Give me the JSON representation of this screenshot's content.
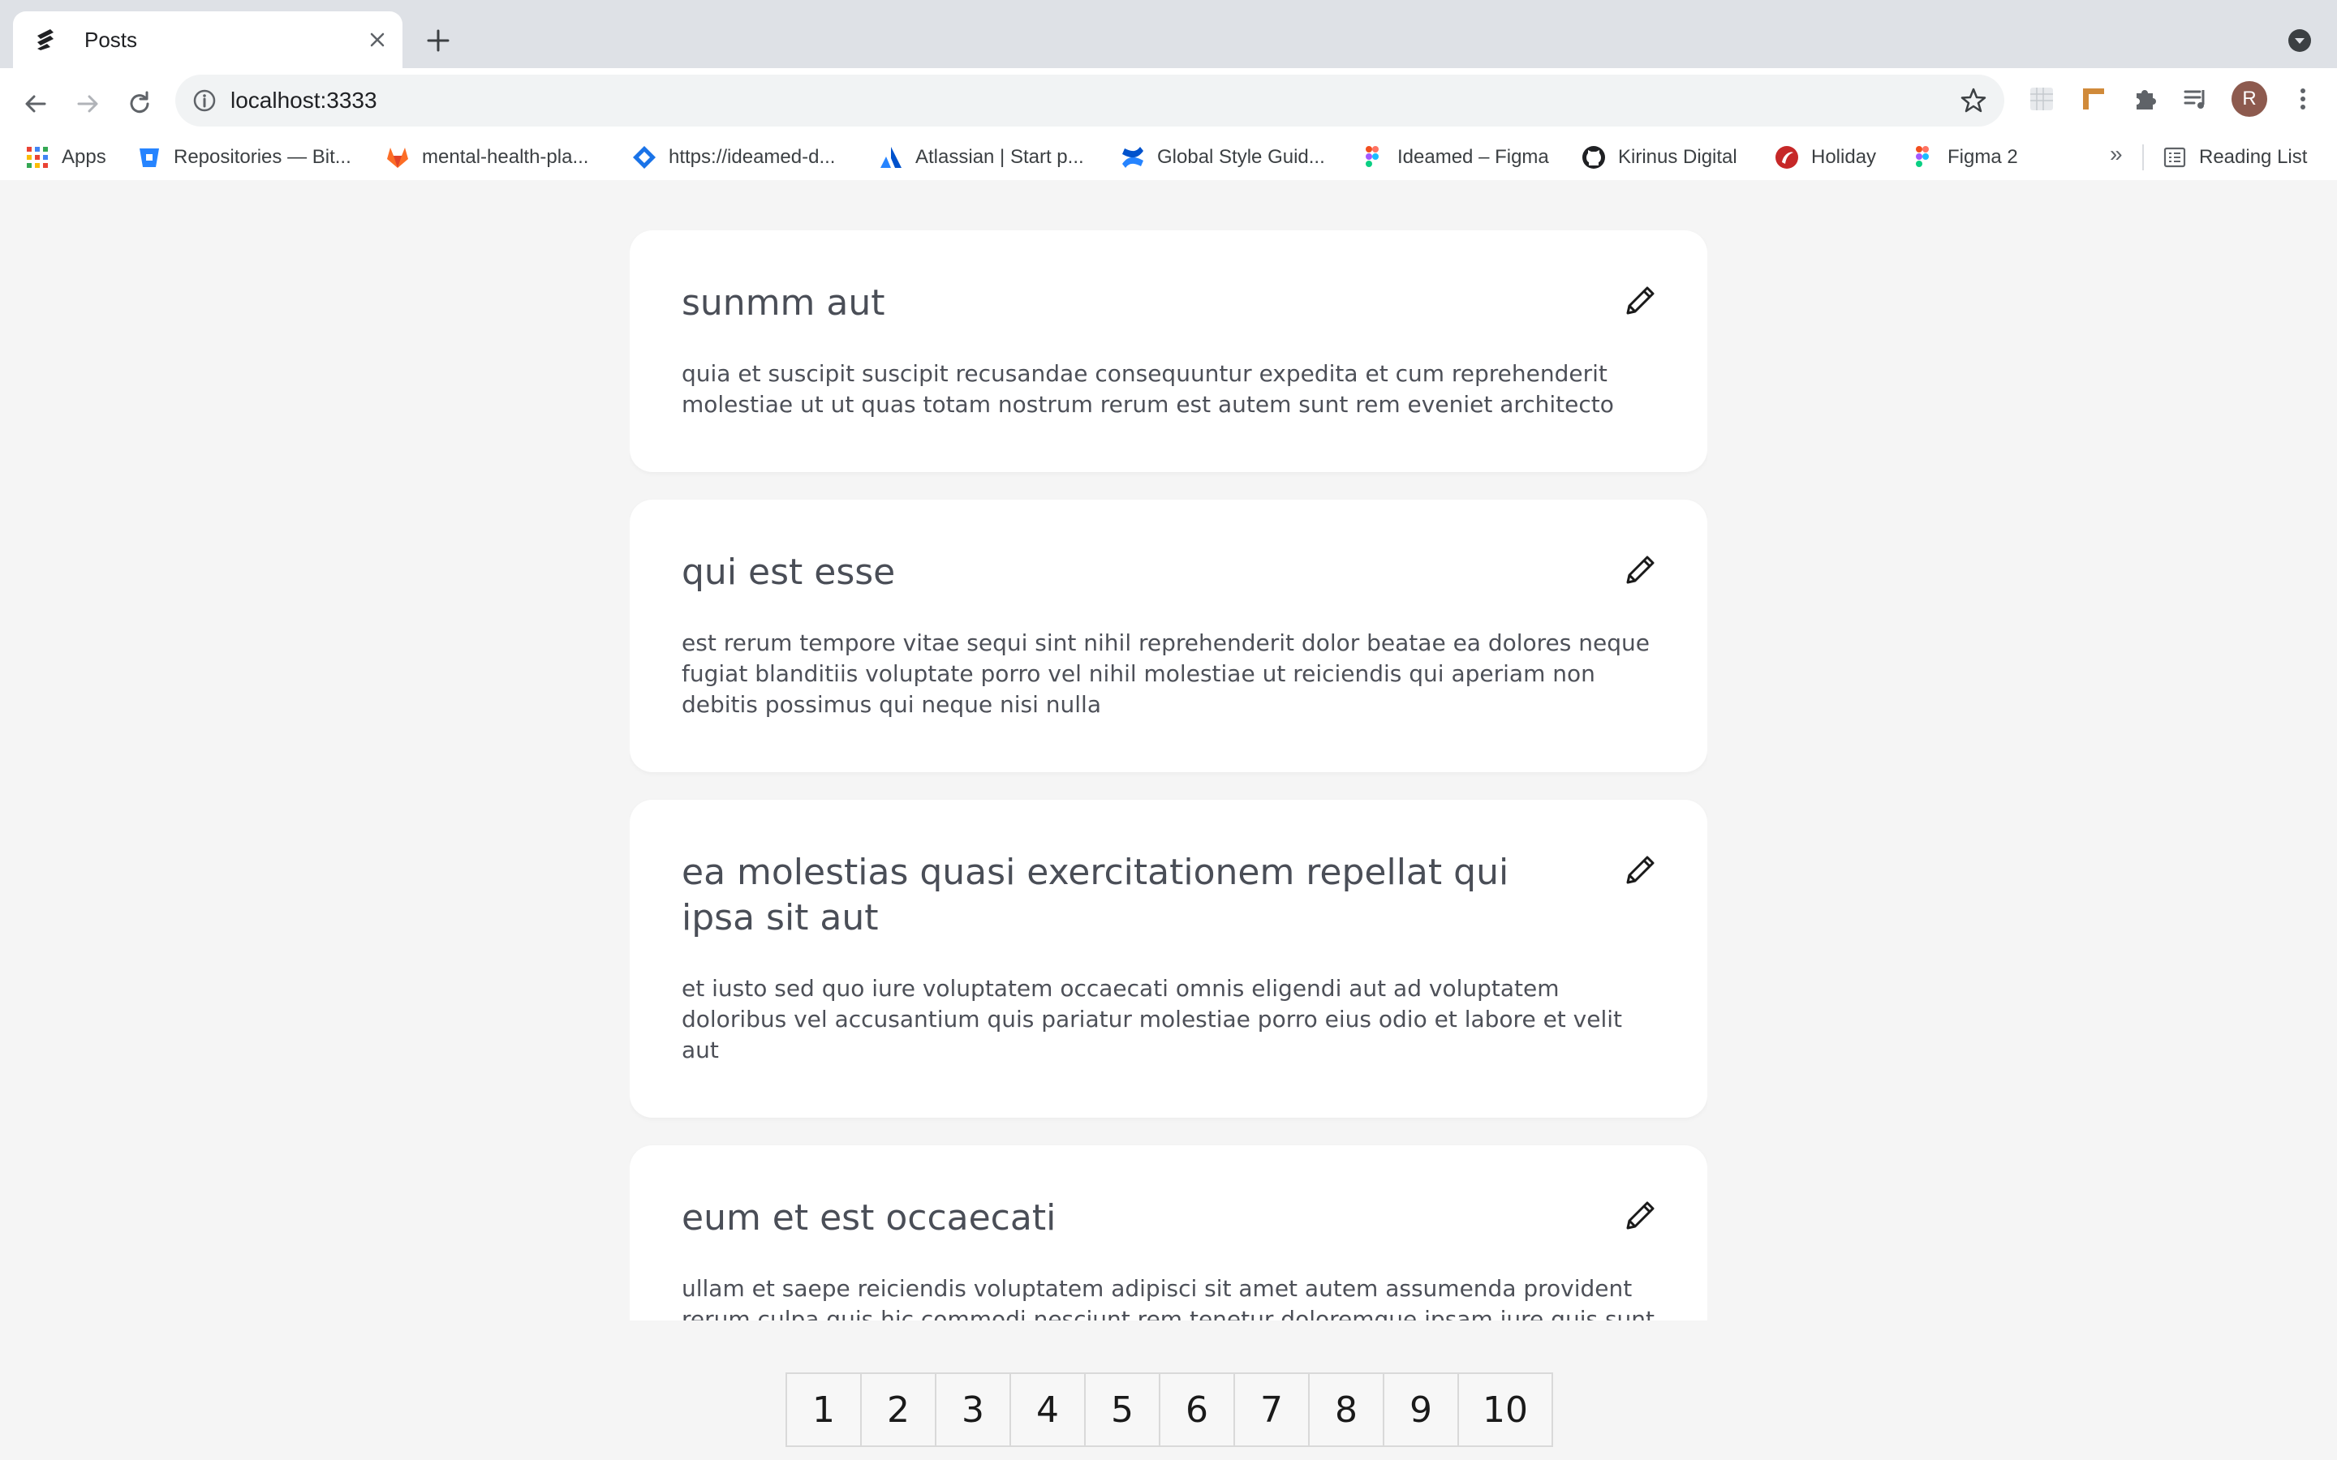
{
  "browser": {
    "tab": {
      "title": "Posts"
    },
    "address": {
      "url": "localhost:3333"
    },
    "profile_initial": "R",
    "bookmarks": [
      {
        "label": "Apps",
        "icon": "apps-grid-icon"
      },
      {
        "label": "Repositories — Bit...",
        "icon": "bitbucket-icon"
      },
      {
        "label": "mental-health-pla...",
        "icon": "gitlab-icon"
      },
      {
        "label": "https://ideamed-d...",
        "icon": "diamond-icon"
      },
      {
        "label": "Atlassian | Start p...",
        "icon": "atlassian-icon"
      },
      {
        "label": "Global Style Guid...",
        "icon": "confluence-icon"
      },
      {
        "label": "Ideamed – Figma",
        "icon": "figma-icon"
      },
      {
        "label": "Kirinus Digital",
        "icon": "github-icon"
      },
      {
        "label": "Holiday",
        "icon": "holiday-icon"
      },
      {
        "label": "Figma 2",
        "icon": "figma-icon"
      }
    ],
    "bookmarks_overflow": "»",
    "reading_list": "Reading List"
  },
  "posts": [
    {
      "title": "sunmm aut",
      "body": "quia et suscipit suscipit recusandae consequuntur expedita et cum reprehenderit molestiae ut ut quas totam nostrum rerum est autem sunt rem eveniet architecto"
    },
    {
      "title": "qui est esse",
      "body": "est rerum tempore vitae sequi sint nihil reprehenderit dolor beatae ea dolores neque fugiat blanditiis voluptate porro vel nihil molestiae ut reiciendis qui aperiam non debitis possimus qui neque nisi nulla"
    },
    {
      "title": "ea molestias quasi exercitationem repellat qui ipsa sit aut",
      "body": "et iusto sed quo iure voluptatem occaecati omnis eligendi aut ad voluptatem doloribus vel accusantium quis pariatur molestiae porro eius odio et labore et velit aut"
    },
    {
      "title": "eum et est occaecati",
      "body": "ullam et saepe reiciendis voluptatem adipisci sit amet autem assumenda provident rerum culpa quis hic commodi nesciunt rem tenetur doloremque ipsam iure quis sunt voluptatem"
    }
  ],
  "pagination": [
    "1",
    "2",
    "3",
    "4",
    "5",
    "6",
    "7",
    "8",
    "9",
    "10"
  ]
}
